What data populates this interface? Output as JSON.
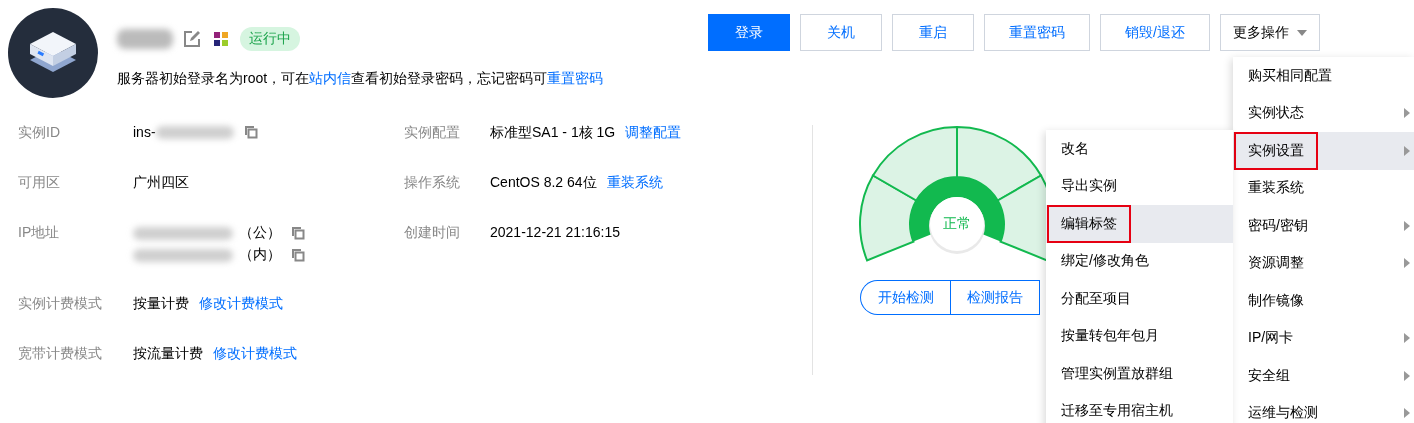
{
  "instance": {
    "name_redacted": true,
    "status": "运行中",
    "hint": [
      {
        "text": "服务器初始登录名为root，可在",
        "link": false
      },
      {
        "text": "站内信",
        "link": true
      },
      {
        "text": "查看初始登录密码，忘记密码可",
        "link": false
      },
      {
        "text": "重置密码",
        "link": true
      }
    ]
  },
  "actions": [
    {
      "label": "登录",
      "kind": "primary"
    },
    {
      "label": "关机",
      "kind": "default"
    },
    {
      "label": "重启",
      "kind": "default"
    },
    {
      "label": "重置密码",
      "kind": "default"
    },
    {
      "label": "销毁/退还",
      "kind": "default"
    },
    {
      "label": "更多操作",
      "kind": "dropdown"
    }
  ],
  "details_left": [
    {
      "label": "实例ID",
      "lines": [
        {
          "text": "ins-",
          "redacted_after": true,
          "copy": true
        }
      ]
    },
    {
      "label": "可用区",
      "lines": [
        {
          "text": "广州四区"
        }
      ]
    },
    {
      "label": "IP地址",
      "lines": [
        {
          "text": "（公）",
          "redacted_before": true,
          "copy": true
        },
        {
          "text": "（内）",
          "redacted_before": true,
          "copy": true
        }
      ]
    },
    {
      "label": "实例计费模式",
      "lines": [
        {
          "text": "按量计费",
          "link": "修改计费模式"
        }
      ]
    },
    {
      "label": "宽带计费模式",
      "lines": [
        {
          "text": "按流量计费",
          "link": "修改计费模式"
        }
      ]
    }
  ],
  "details_right": [
    {
      "label": "实例配置",
      "lines": [
        {
          "text": "标准型SA1 - 1核 1G",
          "link": "调整配置"
        }
      ]
    },
    {
      "label": "操作系统",
      "lines": [
        {
          "text": "CentOS 8.2 64位",
          "link": "重装系统"
        }
      ]
    },
    {
      "label": "创建时间",
      "lines": [
        {
          "text": "2021-12-21 21:16:15"
        }
      ]
    }
  ],
  "health": {
    "status": "正常",
    "buttons": [
      "开始检测",
      "检测报告"
    ]
  },
  "more_menu": {
    "items": [
      {
        "label": "购买相同配置",
        "submenu": false,
        "selected": false,
        "outlined": false
      },
      {
        "label": "实例状态",
        "submenu": true,
        "selected": false,
        "outlined": false
      },
      {
        "label": "实例设置",
        "submenu": true,
        "selected": true,
        "outlined": true
      },
      {
        "label": "重装系统",
        "submenu": false,
        "selected": false,
        "outlined": false
      },
      {
        "label": "密码/密钥",
        "submenu": true,
        "selected": false,
        "outlined": false
      },
      {
        "label": "资源调整",
        "submenu": true,
        "selected": false,
        "outlined": false
      },
      {
        "label": "制作镜像",
        "submenu": false,
        "selected": false,
        "outlined": false
      },
      {
        "label": "IP/网卡",
        "submenu": true,
        "selected": false,
        "outlined": false
      },
      {
        "label": "安全组",
        "submenu": true,
        "selected": false,
        "outlined": false
      },
      {
        "label": "运维与检测",
        "submenu": true,
        "selected": false,
        "outlined": false
      }
    ]
  },
  "sub_menu": {
    "items": [
      {
        "label": "改名",
        "selected": false,
        "outlined": false
      },
      {
        "label": "导出实例",
        "selected": false,
        "outlined": false
      },
      {
        "label": "编辑标签",
        "selected": true,
        "outlined": true
      },
      {
        "label": "绑定/修改角色",
        "selected": false,
        "outlined": false
      },
      {
        "label": "分配至项目",
        "selected": false,
        "outlined": false
      },
      {
        "label": "按量转包年包月",
        "selected": false,
        "outlined": false
      },
      {
        "label": "管理实例置放群组",
        "selected": false,
        "outlined": false
      },
      {
        "label": "迁移至专用宿主机",
        "selected": false,
        "outlined": false
      }
    ]
  }
}
